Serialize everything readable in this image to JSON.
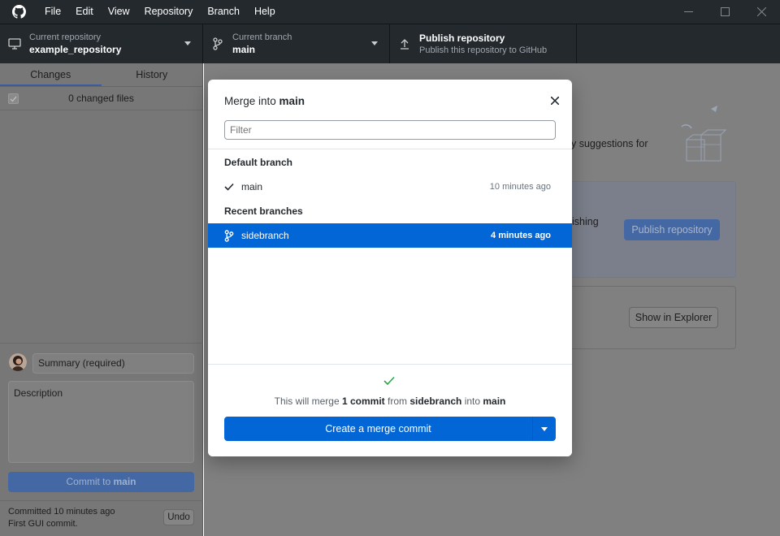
{
  "menu": [
    "File",
    "Edit",
    "View",
    "Repository",
    "Branch",
    "Help"
  ],
  "toolbar": {
    "repo_label": "Current repository",
    "repo_value": "example_repository",
    "branch_label": "Current branch",
    "branch_value": "main",
    "publish_label": "Publish repository",
    "publish_sub": "Publish this repository to GitHub"
  },
  "sidebar": {
    "tab_changes": "Changes",
    "tab_history": "History",
    "changed_files": "0 changed files",
    "summary_placeholder": "Summary (required)",
    "description_placeholder": "Description",
    "commit_prefix": "Commit to ",
    "commit_branch": "main",
    "last_commit_time": "Committed 10 minutes ago",
    "last_commit_msg": "First GUI commit.",
    "undo": "Undo"
  },
  "main": {
    "suggestion_text": "y suggestions for",
    "card_text": "ishing",
    "publish_button": "Publish repository",
    "explorer_button": "Show in Explorer"
  },
  "modal": {
    "title_prefix": "Merge into ",
    "title_branch": "main",
    "filter_placeholder": "Filter",
    "default_header": "Default branch",
    "default_branch": {
      "name": "main",
      "time": "10 minutes ago"
    },
    "recent_header": "Recent branches",
    "recent_branch": {
      "name": "sidebranch",
      "time": "4 minutes ago"
    },
    "msg_pre": "This will merge ",
    "msg_count": "1 commit",
    "msg_from": " from ",
    "msg_source": "sidebranch",
    "msg_into": " into ",
    "msg_target": "main",
    "merge_button": "Create a merge commit"
  },
  "colors": {
    "accent": "#0366d6",
    "success": "#28a745",
    "titlebar": "#24292e"
  }
}
